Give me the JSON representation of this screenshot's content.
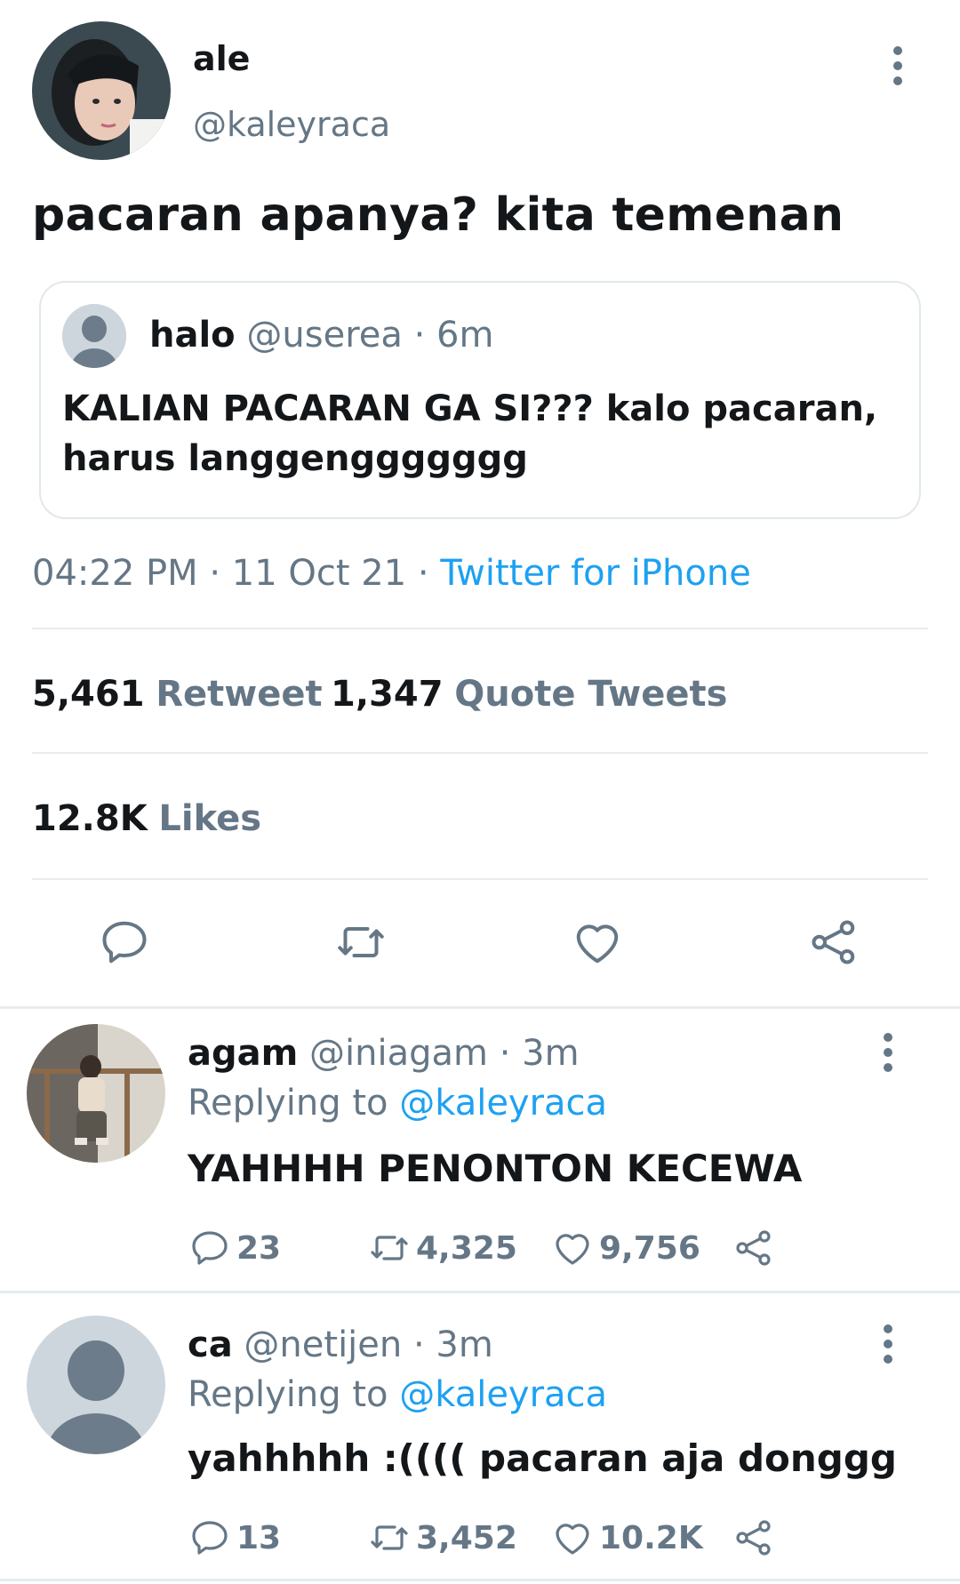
{
  "main_tweet": {
    "name": "ale",
    "handle": "@kaleyraca",
    "text": "pacaran apanya? kita temenan",
    "quote": {
      "name": "halo",
      "handle": "@userea",
      "time": "· 6m",
      "text": "KALIAN PACARAN GA SI??? kalo pacaran, harus langgenggggggg"
    },
    "time": "04:22 PM",
    "date": "· 11 Oct 21 ·",
    "source": "Twitter for iPhone",
    "retweets_count": "5,461",
    "retweets_label": "Retweet",
    "quotes_count": "1,347",
    "quotes_label": "Quote Tweets",
    "likes_count": "12.8K",
    "likes_label": "Likes"
  },
  "replies": [
    {
      "name": "agam",
      "handle": "@iniagam",
      "time": "· 3m",
      "replying_prefix": "Replying to",
      "replying_to": "@kaleyraca",
      "text": "YAHHHH PENONTON KECEWA",
      "reply_count": "23",
      "retweet_count": "4,325",
      "like_count": "9,756"
    },
    {
      "name": "ca",
      "handle": "@netijen",
      "time": "· 3m",
      "replying_prefix": "Replying to",
      "replying_to": "@kaleyraca",
      "text": "yahhhhh :(((( pacaran aja donggg",
      "reply_count": "13",
      "retweet_count": "3,452",
      "like_count": "10.2K"
    }
  ],
  "colors": {
    "accent": "#1da1f2",
    "secondary_text": "#657786",
    "divider": "#e6ecf0"
  },
  "icons": [
    "more-vertical-icon",
    "reply-icon",
    "retweet-icon",
    "like-icon",
    "share-icon",
    "default-avatar-icon"
  ]
}
